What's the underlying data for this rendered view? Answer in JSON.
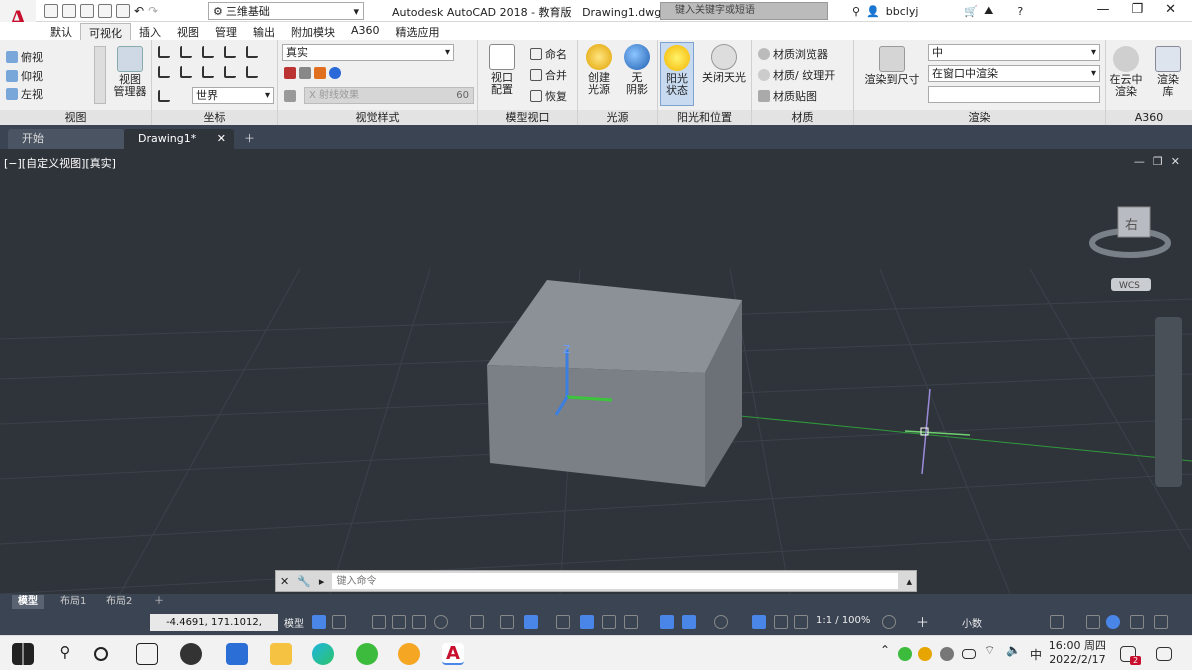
{
  "app": {
    "logo_letter": "A",
    "title": "Autodesk AutoCAD 2018 - 教育版",
    "filename": "Drawing1.dwg",
    "workspace": "三维基础",
    "search_placeholder": "键入关键字或短语",
    "username": "bbclyj"
  },
  "ribbon_tabs": [
    "默认",
    "可视化",
    "插入",
    "视图",
    "管理",
    "输出",
    "附加模块",
    "A360",
    "精选应用"
  ],
  "ribbon_active_tab": "可视化",
  "panels": {
    "view": {
      "title": "视图",
      "items": [
        "俯视",
        "仰视",
        "左视"
      ],
      "manager_label": "视图\n管理器"
    },
    "coords": {
      "title": "坐标",
      "ucs_value": "世界"
    },
    "visual_styles": {
      "title": "视觉样式",
      "style_value": "真实",
      "xray_label": "X 射线效果",
      "xray_value": "60"
    },
    "model_viewports": {
      "title": "模型视口",
      "config_label": "视口\n配置",
      "named_label": "命名",
      "join_label": "合并",
      "restore_label": "恢复"
    },
    "lights": {
      "title": "光源",
      "create_label": "创建\n光源",
      "shadow_label": "无\n阴影"
    },
    "sun": {
      "title": "阳光和位置",
      "state_label": "阳光\n状态",
      "sky_label": "关闭天光"
    },
    "materials": {
      "title": "材质",
      "browser": "材质浏览器",
      "textures": "材质/ 纹理开",
      "mapping": "材质贴图"
    },
    "render": {
      "title": "渲染",
      "render_size_label": "渲染到尺寸",
      "quality": "中",
      "render_in": "在窗口中渲染"
    },
    "a360": {
      "title": "A360",
      "cloud_label": "在云中\n渲染",
      "gallery_label": "渲染\n库"
    }
  },
  "doc_tabs": [
    {
      "label": "开始"
    },
    {
      "label": "Drawing1*"
    }
  ],
  "viewport": {
    "label": "[−][自定义视图][真实]",
    "cube_face": "右",
    "wcs": "WCS",
    "z_axis": "Z"
  },
  "command_placeholder": "键入命令",
  "layout_tabs": [
    "模型",
    "布局1",
    "布局2"
  ],
  "status": {
    "coords": "-4.4691, 171.1012, 0.0000",
    "model": "模型",
    "scale": "1:1 / 100%",
    "units": "小数"
  },
  "taskbar": {
    "time": "16:00 周四",
    "date": "2022/2/17",
    "ime": "中",
    "notif_count": "2"
  },
  "colors": {
    "accent_red": "#c8102e",
    "viewport_bg": "#2f343b",
    "status_bg": "#3b4453"
  }
}
